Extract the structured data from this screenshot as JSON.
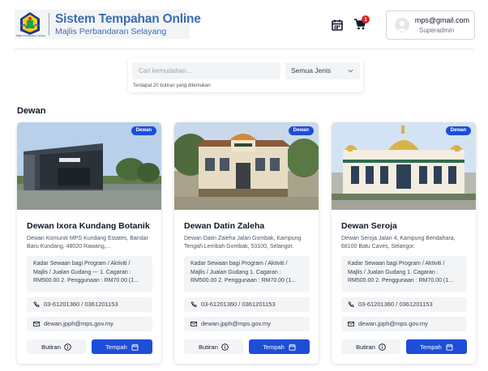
{
  "header": {
    "logo_caption": "Majlis Perbandaran Selayang",
    "title": "Sistem Tempahan Online",
    "subtitle": "Majlis Perbandaran Selayang",
    "cart_count": "1",
    "user": {
      "email": "mps@gmail.com",
      "role": "Superadmin"
    }
  },
  "search": {
    "placeholder": "Cari kemudahan...",
    "type_selected": "Semua Jenis",
    "result_text": "Terdapat 20 butiran yang ditemukan"
  },
  "section": {
    "title": "Dewan"
  },
  "cards": [
    {
      "badge": "Dewan",
      "title": "Dewan Ixora Kundang Botanik",
      "address": "Dewan Komuniti MPS Kundang Estates, Bandar Baru Kundang, 48020 Rawang,...",
      "description": "Kadar Sewaan bagi Program / Aktiviti / Majlis / Jualan Gudang --- 1. Cagaran : RM500.00 2. Penggunaan : RM70.00 (1...",
      "phone": "03-61201360 / 0361201153",
      "email": "dewan.jpph@mps.gov.my",
      "info_label": "Butiran",
      "book_label": "Tempah"
    },
    {
      "badge": "Dewan",
      "title": "Dewan Datin Zaleha",
      "address": "Dewan Datin Zaleha Jalan Gombak, Kampung Tengah Lembah Gombak, 53100, Selangor.",
      "description": "Kadar Sewaan bagi Program / Aktiviti / Majlis / Jualan Gudang 1. Cagaran : RM500.00 2. Penggunaan : RM70.00 (1...",
      "phone": "03-61201360 / 0361201153",
      "email": "dewan.jpph@mps.gov.my",
      "info_label": "Butiran",
      "book_label": "Tempah"
    },
    {
      "badge": "Dewan",
      "title": "Dewan Seroja",
      "address": "Dewan Seroja Jalan 4, Kampung Bendahara, 68100 Batu Caves, Selangor.",
      "description": "Kadar Sewaan bagi Program / Aktiviti / Majlis / Jualan Gudang 1. Cagaran : RM500.00 2. Penggunaan : RM70.00 (1...",
      "phone": "03-61201360 / 0361201153",
      "email": "dewan.jpph@mps.gov.my",
      "info_label": "Butiran",
      "book_label": "Tempah"
    }
  ],
  "colors": {
    "brand": "#3b6db3",
    "primary": "#1d4ed8",
    "badge_alert": "#dc2626"
  },
  "icons": [
    "calendar-icon",
    "cart-icon",
    "chevron-down-icon",
    "phone-icon",
    "mail-icon",
    "info-icon",
    "calendar-icon"
  ]
}
